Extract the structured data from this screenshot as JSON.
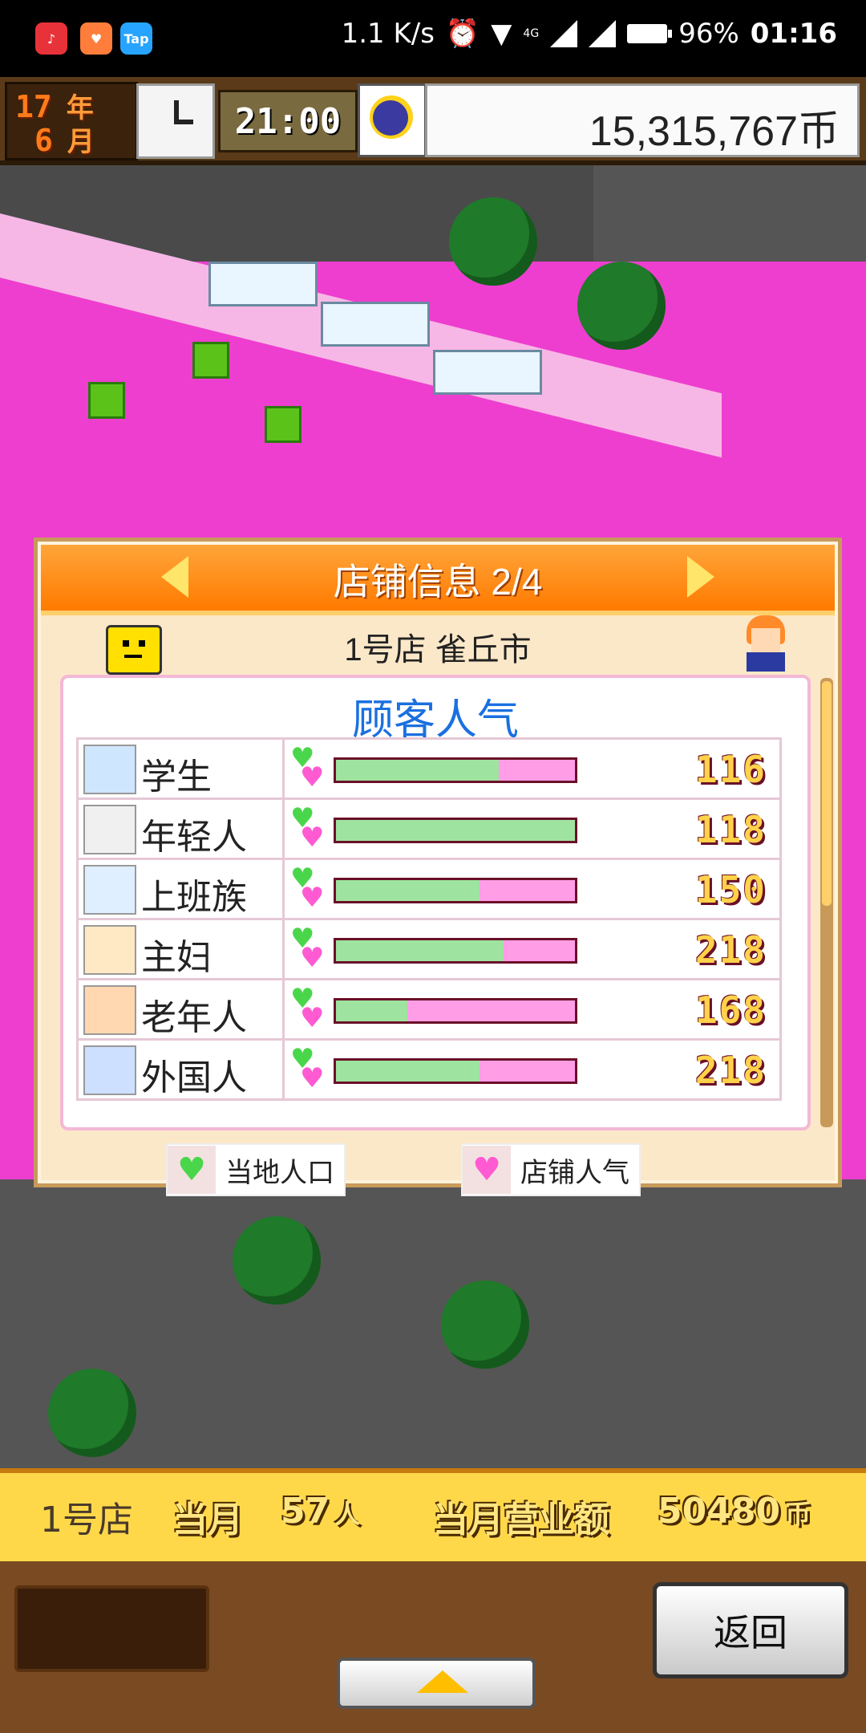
{
  "status_bar": {
    "apps": [
      "netease",
      "heart",
      "Tap"
    ],
    "network_speed": "1.1 K/s",
    "signal": "4G",
    "battery": "96%",
    "time": "01:16"
  },
  "top_bar": {
    "year": "17",
    "year_unit": "年",
    "month": "6",
    "month_unit": "月",
    "game_time": "21:00",
    "money": "15,315,767币"
  },
  "dialog": {
    "title": "店铺信息 2/4",
    "store_line": "1号店 雀丘市",
    "panel_title": "顾客人气",
    "rows": [
      {
        "label": "学生",
        "value": "116",
        "local_fraction": 0.68,
        "icon": "school-icon"
      },
      {
        "label": "年轻人",
        "value": "118",
        "local_fraction": 1.0,
        "icon": "shoe-icon"
      },
      {
        "label": "上班族",
        "value": "150",
        "local_fraction": 0.6,
        "icon": "office-building-icon"
      },
      {
        "label": "主妇",
        "value": "218",
        "local_fraction": 0.7,
        "icon": "house-icon"
      },
      {
        "label": "老年人",
        "value": "168",
        "local_fraction": 0.3,
        "icon": "maple-leaf-icon"
      },
      {
        "label": "外国人",
        "value": "218",
        "local_fraction": 0.6,
        "icon": "airplane-icon"
      }
    ],
    "legend": {
      "local_population": "当地人口",
      "store_popularity": "店铺人气"
    }
  },
  "info_bar": {
    "store": "1号店",
    "month_label": "当月",
    "customers": "57",
    "customers_unit": "人",
    "sales_label": "当月营业额",
    "sales_value": "50480",
    "sales_unit": "币"
  },
  "controls": {
    "back_label": "返回"
  },
  "colors": {
    "accent_orange": "#ff7a00",
    "panel_title_blue": "#1a70e0",
    "local_bar_green": "#9fe3a0",
    "popularity_bar_pink": "#ff9ee6"
  }
}
